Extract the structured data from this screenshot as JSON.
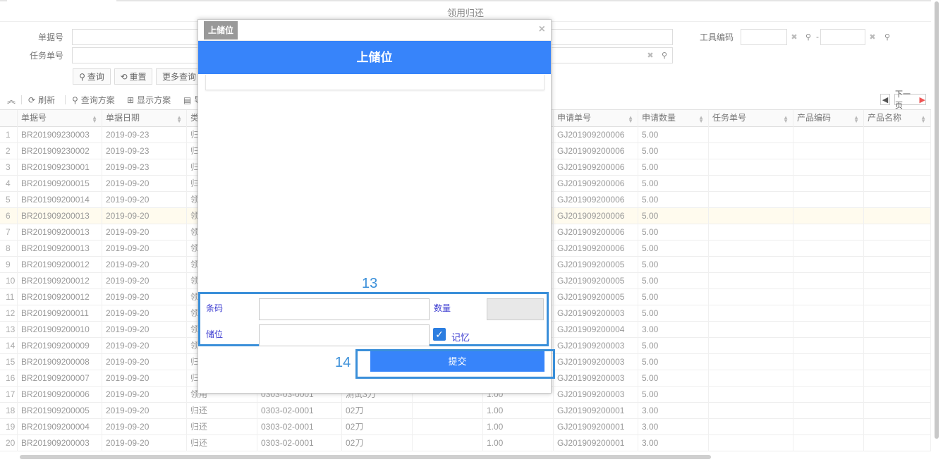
{
  "page_title": "领用归还",
  "filters": {
    "bill_no_label": "单据号",
    "task_no_label": "任务单号",
    "tool_code_label": "工具编码",
    "range_dash": "-",
    "query_button": "查询",
    "reset_button": "重置",
    "more_query_button": "更多查询"
  },
  "toolbar": {
    "refresh": "刷新",
    "query_scheme": "查询方案",
    "display_scheme": "显示方案",
    "export_partial": "导",
    "next_page": "下一页"
  },
  "grid": {
    "columns": [
      {
        "key": "bill_no",
        "label": "单据号"
      },
      {
        "key": "bill_date",
        "label": "单据日期"
      },
      {
        "key": "type",
        "label": "类"
      },
      {
        "key": "c4",
        "label": ""
      },
      {
        "key": "c5",
        "label": ""
      },
      {
        "key": "c6",
        "label": ""
      },
      {
        "key": "c7",
        "label": ""
      },
      {
        "key": "apply_no",
        "label": "申请单号"
      },
      {
        "key": "apply_qty",
        "label": "申请数量"
      },
      {
        "key": "task_no",
        "label": "任务单号"
      },
      {
        "key": "product_code",
        "label": "产品编码"
      },
      {
        "key": "product_name",
        "label": "产品名称"
      }
    ],
    "selected_row": 6,
    "rows": [
      {
        "n": "1",
        "bill_no": "BR201909230003",
        "bill_date": "2019-09-23",
        "type": "归",
        "c4": "",
        "c5": "",
        "c6": "",
        "c7": "",
        "apply_no": "GJ201909200006",
        "apply_qty": "5.00"
      },
      {
        "n": "2",
        "bill_no": "BR201909230002",
        "bill_date": "2019-09-23",
        "type": "归",
        "c4": "",
        "c5": "",
        "c6": "",
        "c7": "",
        "apply_no": "GJ201909200006",
        "apply_qty": "5.00"
      },
      {
        "n": "3",
        "bill_no": "BR201909230001",
        "bill_date": "2019-09-23",
        "type": "归",
        "c4": "",
        "c5": "",
        "c6": "",
        "c7": "",
        "apply_no": "GJ201909200006",
        "apply_qty": "5.00"
      },
      {
        "n": "4",
        "bill_no": "BR201909200015",
        "bill_date": "2019-09-20",
        "type": "归",
        "c4": "",
        "c5": "",
        "c6": "",
        "c7": "",
        "apply_no": "GJ201909200006",
        "apply_qty": "5.00"
      },
      {
        "n": "5",
        "bill_no": "BR201909200014",
        "bill_date": "2019-09-20",
        "type": "领",
        "c4": "",
        "c5": "",
        "c6": "",
        "c7": "",
        "apply_no": "GJ201909200006",
        "apply_qty": "5.00"
      },
      {
        "n": "6",
        "bill_no": "BR201909200013",
        "bill_date": "2019-09-20",
        "type": "领",
        "c4": "",
        "c5": "",
        "c6": "",
        "c7": "",
        "apply_no": "GJ201909200006",
        "apply_qty": "5.00"
      },
      {
        "n": "7",
        "bill_no": "BR201909200013",
        "bill_date": "2019-09-20",
        "type": "领",
        "c4": "",
        "c5": "",
        "c6": "",
        "c7": "",
        "apply_no": "GJ201909200006",
        "apply_qty": "5.00"
      },
      {
        "n": "8",
        "bill_no": "BR201909200013",
        "bill_date": "2019-09-20",
        "type": "领",
        "c4": "",
        "c5": "",
        "c6": "",
        "c7": "",
        "apply_no": "GJ201909200006",
        "apply_qty": "5.00"
      },
      {
        "n": "9",
        "bill_no": "BR201909200012",
        "bill_date": "2019-09-20",
        "type": "领",
        "c4": "",
        "c5": "",
        "c6": "",
        "c7": "",
        "apply_no": "GJ201909200005",
        "apply_qty": "5.00"
      },
      {
        "n": "10",
        "bill_no": "BR201909200012",
        "bill_date": "2019-09-20",
        "type": "领",
        "c4": "",
        "c5": "",
        "c6": "",
        "c7": "",
        "apply_no": "GJ201909200005",
        "apply_qty": "5.00"
      },
      {
        "n": "11",
        "bill_no": "BR201909200012",
        "bill_date": "2019-09-20",
        "type": "领",
        "c4": "",
        "c5": "",
        "c6": "",
        "c7": "",
        "apply_no": "GJ201909200005",
        "apply_qty": "5.00"
      },
      {
        "n": "12",
        "bill_no": "BR201909200011",
        "bill_date": "2019-09-20",
        "type": "领",
        "c4": "",
        "c5": "",
        "c6": "",
        "c7": "",
        "apply_no": "GJ201909200003",
        "apply_qty": "5.00"
      },
      {
        "n": "13",
        "bill_no": "BR201909200010",
        "bill_date": "2019-09-20",
        "type": "领",
        "c4": "",
        "c5": "",
        "c6": "",
        "c7": "",
        "apply_no": "GJ201909200004",
        "apply_qty": "3.00"
      },
      {
        "n": "14",
        "bill_no": "BR201909200009",
        "bill_date": "2019-09-20",
        "type": "领",
        "c4": "",
        "c5": "",
        "c6": "",
        "c7": "",
        "apply_no": "GJ201909200003",
        "apply_qty": "5.00"
      },
      {
        "n": "15",
        "bill_no": "BR201909200008",
        "bill_date": "2019-09-20",
        "type": "归",
        "c4": "",
        "c5": "",
        "c6": "",
        "c7": "",
        "apply_no": "GJ201909200003",
        "apply_qty": "5.00"
      },
      {
        "n": "16",
        "bill_no": "BR201909200007",
        "bill_date": "2019-09-20",
        "type": "归",
        "c4": "",
        "c5": "",
        "c6": "",
        "c7": "",
        "apply_no": "GJ201909200003",
        "apply_qty": "5.00"
      },
      {
        "n": "17",
        "bill_no": "BR201909200006",
        "bill_date": "2019-09-20",
        "type": "领用",
        "c4": "0303-03-0001",
        "c5": "测试3刀",
        "c6": "",
        "c7": "1.00",
        "apply_no": "GJ201909200003",
        "apply_qty": "5.00"
      },
      {
        "n": "18",
        "bill_no": "BR201909200005",
        "bill_date": "2019-09-20",
        "type": "归还",
        "c4": "0303-02-0001",
        "c5": "02刀",
        "c6": "",
        "c7": "1.00",
        "apply_no": "GJ201909200001",
        "apply_qty": "3.00"
      },
      {
        "n": "19",
        "bill_no": "BR201909200004",
        "bill_date": "2019-09-20",
        "type": "归还",
        "c4": "0303-02-0001",
        "c5": "02刀",
        "c6": "",
        "c7": "1.00",
        "apply_no": "GJ201909200001",
        "apply_qty": "3.00"
      },
      {
        "n": "20",
        "bill_no": "BR201909200003",
        "bill_date": "2019-09-20",
        "type": "归还",
        "c4": "0303-02-0001",
        "c5": "02刀",
        "c6": "",
        "c7": "1.00",
        "apply_no": "GJ201909200001",
        "apply_qty": "3.00"
      }
    ]
  },
  "modal": {
    "tab_label": "上储位",
    "close_glyph": "×",
    "header_title": "上储位",
    "barcode_label": "条码",
    "barcode_value": "",
    "qty_label": "数量",
    "qty_value": "",
    "location_label": "储位",
    "location_value": "",
    "remember_label": "记忆",
    "remember_checked": true,
    "submit_label": "提交"
  },
  "annotations": {
    "box13": "13",
    "box14": "14"
  },
  "colors": {
    "accent_blue": "#3784fa",
    "annotation_blue": "#3a8fd9",
    "selected_row_bg": "#fffbee"
  }
}
